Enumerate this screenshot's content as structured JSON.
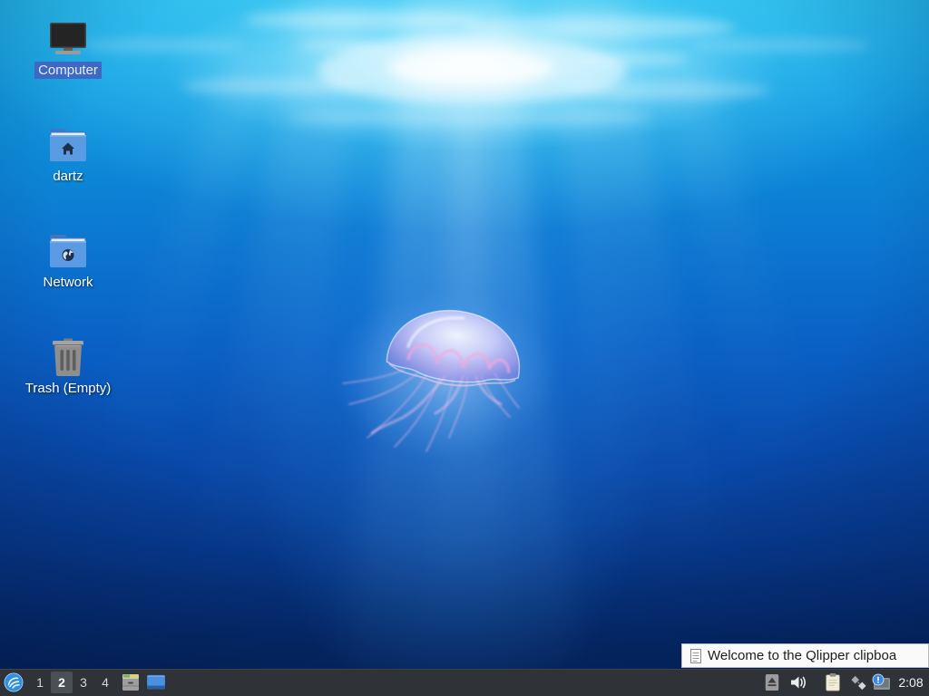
{
  "colors": {
    "taskbar_bg": "#2f3338",
    "workspace_active_bg": "#4b5057",
    "selection_bg": "#3f67c4",
    "folder_blue": "#5b9be3",
    "tooltip_bg": "#fafafa"
  },
  "desktop": {
    "icons": [
      {
        "label": "Computer",
        "icon": "computer-icon",
        "selected": true
      },
      {
        "label": "dartz",
        "icon": "home-folder-icon",
        "selected": false
      },
      {
        "label": "Network",
        "icon": "network-folder-icon",
        "selected": false
      },
      {
        "label": "Trash (Empty)",
        "icon": "trash-empty-icon",
        "selected": false
      }
    ]
  },
  "taskbar": {
    "menu_button": {
      "icon": "lubuntu-logo-icon"
    },
    "workspaces": [
      {
        "label": "1",
        "active": false
      },
      {
        "label": "2",
        "active": true
      },
      {
        "label": "3",
        "active": false
      },
      {
        "label": "4",
        "active": false
      }
    ],
    "quicklaunch": [
      {
        "icon": "file-manager-icon"
      },
      {
        "icon": "show-desktop-icon"
      }
    ],
    "tray": [
      {
        "icon": "removable-media-icon"
      },
      {
        "icon": "volume-icon"
      },
      {
        "icon": "clipboard-icon"
      },
      {
        "icon": "network-icon"
      },
      {
        "icon": "update-notifier-icon"
      }
    ],
    "clock": "2:08"
  },
  "notification": {
    "icon": "qlipper-icon",
    "text": "Welcome to the Qlipper clipboa"
  }
}
